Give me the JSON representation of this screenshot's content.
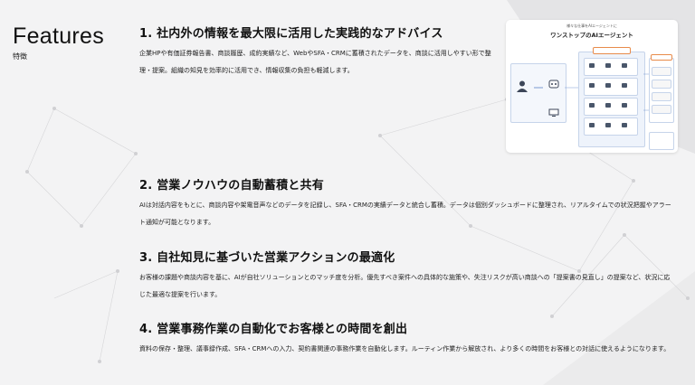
{
  "header": {
    "title": "Features",
    "subtitle": "特徴"
  },
  "features": [
    {
      "title": "1. 社内外の情報を最大限に活用した実践的なアドバイス",
      "text": "企業HPや有価証券報告書、商談履歴、成約実績など、WebやSFA・CRMに蓄積されたデータを、商談に活用しやすい形で整理・提案。組織の知見を効率的に活用でき、情報収集の負担も軽減します。"
    },
    {
      "title": "2. 営業ノウハウの自動蓄積と共有",
      "text": "AIは対話内容をもとに、商談内容や架電音声などのデータを記録し、SFA・CRMの実績データと統合し蓄積。データは個別ダッシュボードに整理され、リアルタイムでの状況把握やアラート通知が可能となります。"
    },
    {
      "title": "3. 自社知見に基づいた営業アクションの最適化",
      "text": "お客様の課題や商談内容を基に、AIが自社ソリューションとのマッチ度を分析。優先すべき案件への具体的な施策や、失注リスクが高い商談への「提案書の見直し」の提案など、状況に応じた最適な提案を行います。"
    },
    {
      "title": "4. 営業事務作業の自動化でお客様との時間を創出",
      "text": "資料の保存・整理、議事録作成、SFA・CRMへの入力、契約書関連の事務作業を自動化します。ルーティン作業から解放され、より多くの時間をお客様との対話に使えるようになります。"
    }
  ],
  "diagram": {
    "subtitle": "様々な仕事をAIエージェントに",
    "title": "ワンストップのAIエージェント"
  }
}
